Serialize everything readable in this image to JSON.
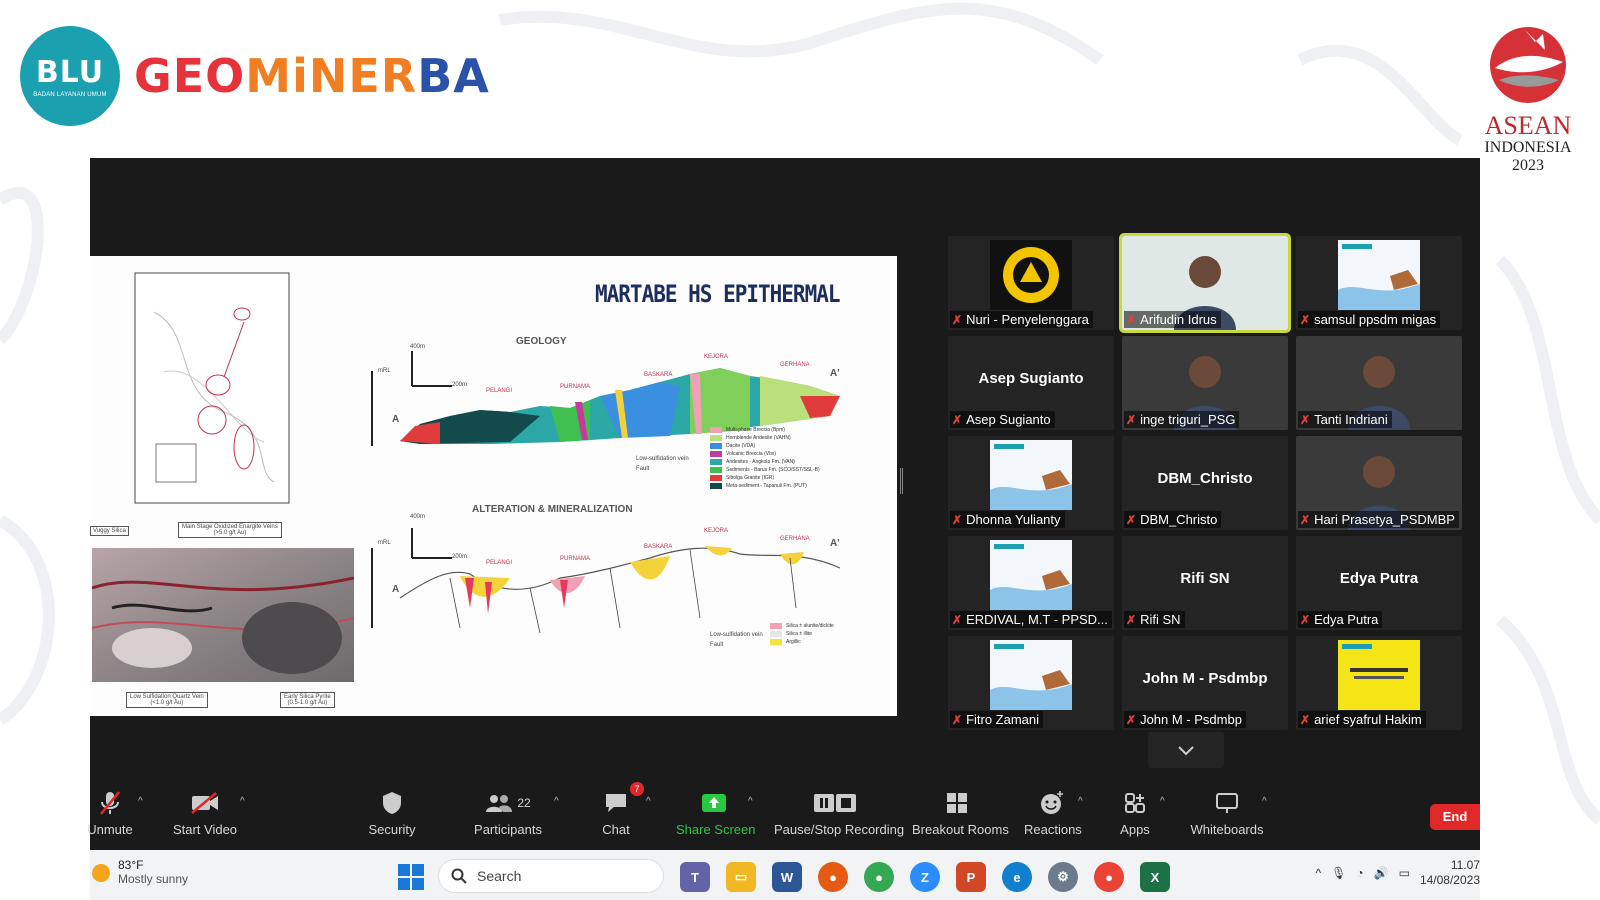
{
  "branding": {
    "blu": "BLU",
    "blu_sub": "BADAN LAYANAN UMUM",
    "geo_1": "GEO",
    "geo_2": "MiNER",
    "geo_3": "BA",
    "asean_1": "ASEAN",
    "asean_2": "INDONESIA",
    "asean_3": "2023"
  },
  "slide": {
    "title": "MARTABE HS EPITHERMAL",
    "geology": "GEOLOGY",
    "alteration": "ALTERATION & MINERALIZATION",
    "places": [
      "PELANGI",
      "PURNAMA",
      "BASKARA",
      "KEJORA",
      "GERHANA"
    ],
    "label_a": "A",
    "label_a_prime": "A'",
    "mrl": "mRL",
    "scale_400": "400m",
    "scale_200": "200m",
    "legend_geology": [
      "Multi-phase Breccia (Bpm)",
      "Hornblende Andesite (VAHN)",
      "Dacite (VDA)",
      "Volcanic Breccia (Vbx)",
      "Andesites - Angkola Fm. (VAN)",
      "Sediments - Barus Fm. (SCO/SST/SSL-B)",
      "Sibolga Granite (IGR)",
      "Meta-sediment - Tapanuli Fm. (PUT)"
    ],
    "legend_alteration": [
      "Silica ± alunite/dickite",
      "Silica ± illite",
      "Argillic"
    ],
    "low_sulf": "Low-sulfidation vein",
    "fault": "Fault",
    "vuggy": "Vuggy Silica",
    "main_stage": "Main Stage Oxidized Enargite Veins",
    "main_stage_grade": "(>5.0 g/t Au)",
    "low_sulf_quartz": "Low Sulfidation Quartz Vein",
    "low_sulf_quartz_grade": "(<1.0 g/t Au)",
    "early_silica": "Early Silica Pyrite",
    "early_silica_grade": "(0.5-1.0 g/t Au)"
  },
  "participants": [
    {
      "name": "Nuri - Penyelenggara",
      "type": "logo"
    },
    {
      "name": "Arifudin Idrus",
      "type": "video",
      "active": true
    },
    {
      "name": "samsul ppsdm migas",
      "type": "slide"
    },
    {
      "name": "Asep Sugianto",
      "type": "text"
    },
    {
      "name": "inge triguri_PSG",
      "type": "video"
    },
    {
      "name": "Tanti Indriani",
      "type": "video"
    },
    {
      "name": "Dhonna Yulianty",
      "type": "slide"
    },
    {
      "name": "DBM_Christo",
      "type": "text"
    },
    {
      "name": "Hari Prasetya_PSDMBP",
      "type": "video"
    },
    {
      "name": "ERDIVAL, M.T - PPSD...",
      "type": "slide"
    },
    {
      "name": "Rifi SN",
      "type": "text"
    },
    {
      "name": "Edya Putra",
      "type": "text"
    },
    {
      "name": "Fitro Zamani",
      "type": "slide"
    },
    {
      "name": "John M - Psdmbp",
      "type": "text"
    },
    {
      "name": "arief syafrul Hakim",
      "type": "yellow"
    }
  ],
  "toolbar": {
    "unmute": "Unmute",
    "start_video": "Start Video",
    "security": "Security",
    "participants": "Participants",
    "participants_count": "22",
    "chat": "Chat",
    "chat_badge": "7",
    "share_screen": "Share Screen",
    "recording": "Pause/Stop Recording",
    "breakout": "Breakout Rooms",
    "reactions": "Reactions",
    "apps": "Apps",
    "whiteboards": "Whiteboards",
    "end": "End"
  },
  "taskbar": {
    "temp": "83°F",
    "condition": "Mostly sunny",
    "search": "Search",
    "time": "11.07",
    "date": "14/08/2023"
  },
  "colors": {
    "zoom_bg": "#1a1a1a",
    "share_green": "#28c940",
    "end_red": "#e02828",
    "active_border": "#c8d83c"
  }
}
